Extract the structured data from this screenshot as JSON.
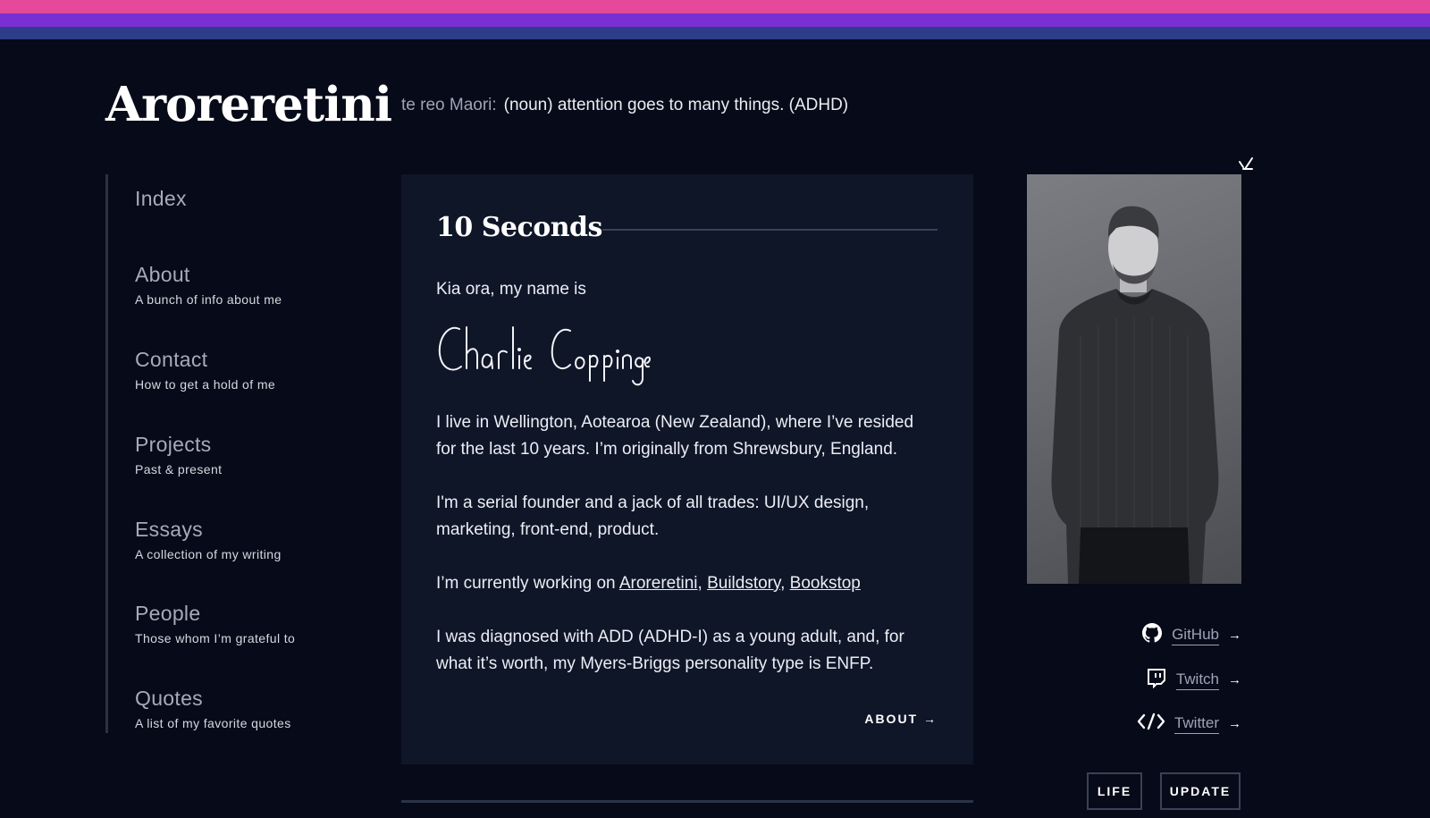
{
  "site": {
    "brand": "Aroreretini",
    "tagline_lang": "te reo Maori:",
    "tagline_text": "(noun) attention goes to many things. (ADHD)"
  },
  "sidebar": {
    "items": [
      {
        "label": "Index",
        "sub": ""
      },
      {
        "label": "About",
        "sub": "A bunch of info about me"
      },
      {
        "label": "Contact",
        "sub": "How to get a hold of me"
      },
      {
        "label": "Projects",
        "sub": "Past & present"
      },
      {
        "label": "Essays",
        "sub": "A collection of my writing"
      },
      {
        "label": "People",
        "sub": "Those whom I’m grateful to"
      },
      {
        "label": "Quotes",
        "sub": "A list of my favorite quotes"
      }
    ]
  },
  "main": {
    "title": "10 Seconds",
    "intro": "Kia ora, my name is",
    "signature_name": "Charlie Coppinger",
    "p1": "I live in Wellington, Aotearoa (New Zealand), where I’ve resided for the last 10 years. I’m originally from Shrewsbury, England.",
    "p2": "I'm a serial founder and a jack of all trades: UI/UX design, marketing, front-end, product.",
    "p3_prefix": "I’m currently working on ",
    "projects": [
      "Aroreretini",
      "Buildstory",
      "Bookstop"
    ],
    "p4": "I was diagnosed with ADD (ADHD-I) as a young adult, and, for what it’s worth, my Myers-Briggs personality type is ENFP.",
    "about_link": "ABOUT →"
  },
  "social": [
    {
      "label": "GitHub",
      "icon": "github-icon"
    },
    {
      "label": "Twitch",
      "icon": "twitch-icon"
    },
    {
      "label": "Twitter",
      "icon": "code-icon"
    }
  ],
  "tags": [
    "LIFE",
    "UPDATE"
  ],
  "colors": {
    "background": "#070a18",
    "card": "#0f1628",
    "stripe_pink": "#e6489a",
    "stripe_purple": "#7a2fd4",
    "stripe_blue": "#2e3d8a"
  }
}
